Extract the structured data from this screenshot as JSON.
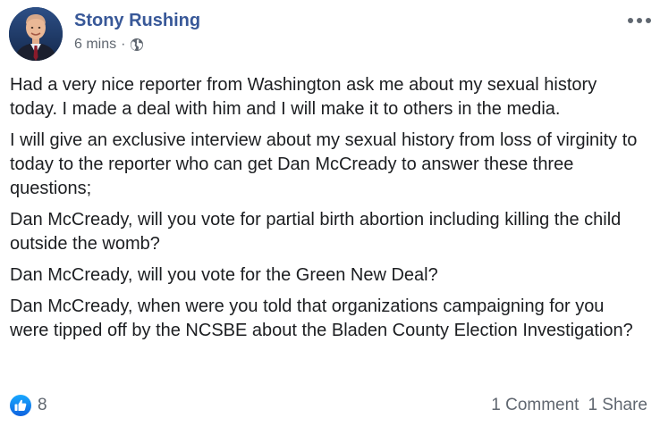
{
  "post": {
    "author": "Stony Rushing",
    "timestamp": "6 mins",
    "separator": "·",
    "audience_icon": "globe-icon",
    "more_icon": "more-options-icon",
    "paragraphs": [
      "Had a very nice reporter from Washington ask me about my sexual history today. I made a deal with him and I will make it to others in the media.",
      "I will give an exclusive interview about my sexual history from loss of virginity to today to the reporter who can get Dan McCready to answer these three questions;",
      "Dan McCready, will you vote for partial birth abortion including killing the child outside the womb?",
      "Dan McCready, will you vote for the Green New Deal?",
      "Dan McCready, when were you told that organizations campaigning for you were tipped off by the NCSBE about the Bladen County Election Investigation?"
    ]
  },
  "footer": {
    "like_icon": "like-thumb-icon",
    "reaction_count": "8",
    "comments": "1 Comment",
    "shares": "1 Share"
  },
  "colors": {
    "author_link": "#385898",
    "meta_text": "#606770",
    "body_text": "#1c1e21",
    "like_blue": "#1877f2"
  }
}
